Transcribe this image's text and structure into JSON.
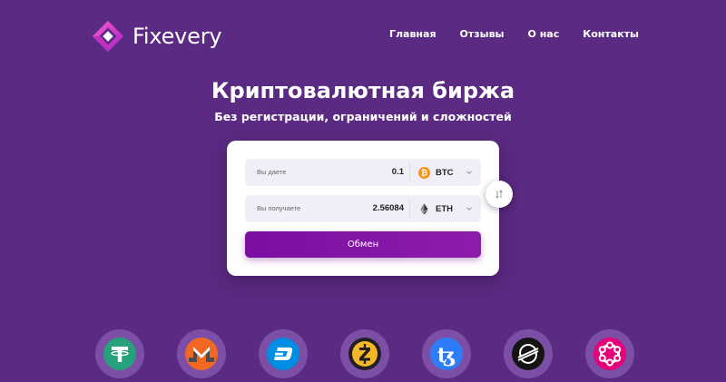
{
  "header": {
    "logo_text": "Fixevery",
    "nav": [
      "Главная",
      "Отзывы",
      "О нас",
      "Контакты"
    ]
  },
  "hero": {
    "title": "Криптовалютная биржа",
    "subtitle": "Без регистрации, ограничений и сложностей"
  },
  "exchange": {
    "give": {
      "label": "Вы даете",
      "value": "0.1",
      "currency": "BTC"
    },
    "get": {
      "label": "Вы получаете",
      "value": "2.56084",
      "currency": "ETH"
    },
    "button_label": "Обмен"
  },
  "coins": [
    {
      "icon": "tether-icon",
      "color": "#26a17b"
    },
    {
      "icon": "monero-icon",
      "color": "#f26822"
    },
    {
      "icon": "dash-icon",
      "color": "#008de4"
    },
    {
      "icon": "zcash-icon",
      "color": "#f4b728"
    },
    {
      "icon": "tezos-icon",
      "color": "#2c7df7"
    },
    {
      "icon": "stellar-icon",
      "color": "#1a1a1a"
    },
    {
      "icon": "polkadot-icon",
      "color": "#e6007a"
    }
  ],
  "colors": {
    "background": "#5b2a82",
    "accent": "#7b0fa3",
    "bitcoin": "#f7931a"
  }
}
